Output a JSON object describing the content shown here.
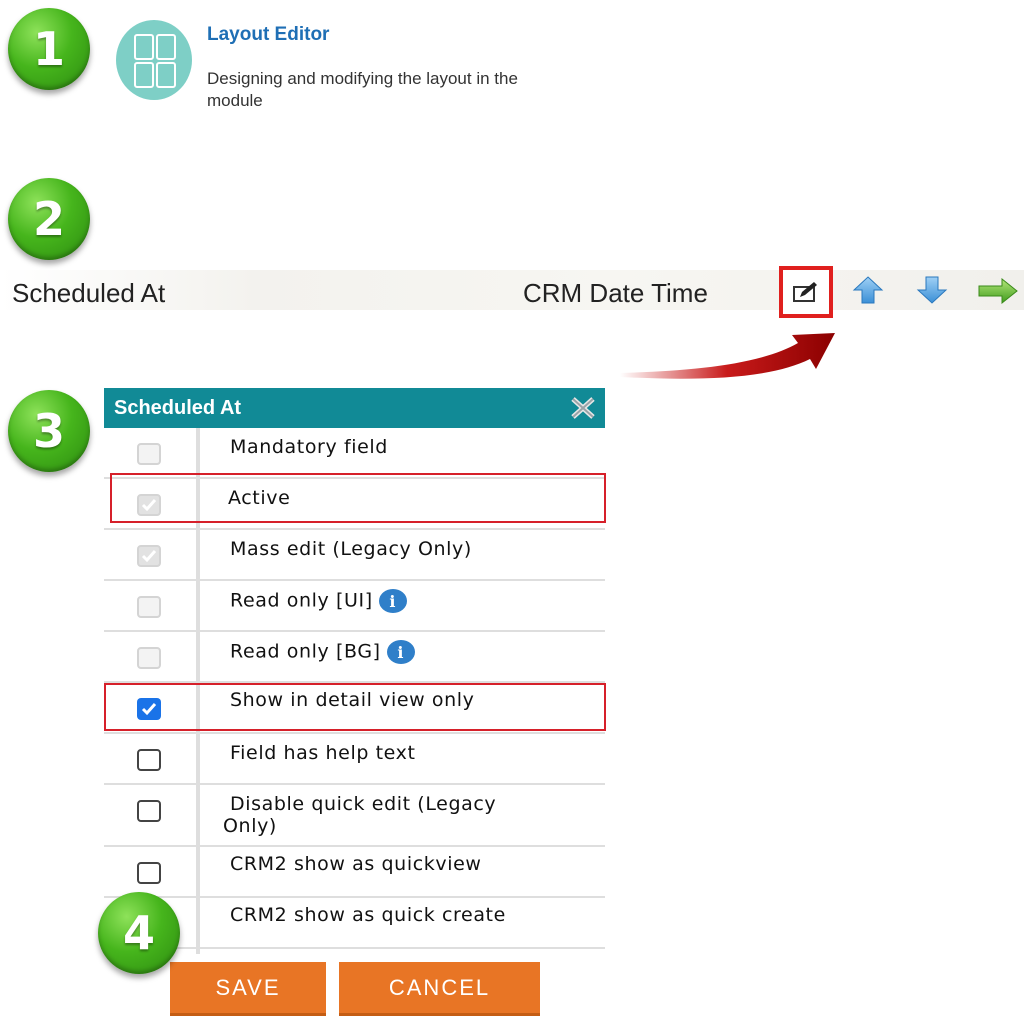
{
  "steps": [
    "1",
    "2",
    "3",
    "4"
  ],
  "layout_editor": {
    "icon": "layout-grid-icon",
    "title": "Layout Editor",
    "description": "Designing and modifying the layout in the module"
  },
  "field_row": {
    "label": "Scheduled At",
    "type": "CRM Date Time",
    "icons": [
      "edit-icon",
      "arrow-up-icon",
      "arrow-down-icon",
      "arrow-right-icon"
    ]
  },
  "dialog": {
    "title": "Scheduled At",
    "options": [
      {
        "label": "Mandatory field",
        "state": "disabled"
      },
      {
        "label": "Active",
        "state": "disabled-checked"
      },
      {
        "label": "Mass edit (Legacy Only)",
        "state": "disabled-checked"
      },
      {
        "label": "Read only [UI]",
        "state": "disabled",
        "info": true
      },
      {
        "label": "Read only [BG]",
        "state": "disabled",
        "info": true
      },
      {
        "label": "Show in detail view only",
        "state": "checked"
      },
      {
        "label": "Field has help text",
        "state": "unchecked"
      },
      {
        "label_line1": "Disable quick edit (Legacy",
        "label_line2": "Only)",
        "state": "unchecked"
      },
      {
        "label": "CRM2 show as quickview",
        "state": "unchecked"
      },
      {
        "label": "CRM2 show as quick create",
        "state": "unchecked"
      }
    ],
    "info_glyph": "i"
  },
  "buttons": {
    "save": "SAVE",
    "cancel": "CANCEL"
  },
  "colors": {
    "header": "#118a96",
    "button": "#e87525",
    "highlight": "#d6202a",
    "checkbox_checked": "#1a73e8"
  }
}
